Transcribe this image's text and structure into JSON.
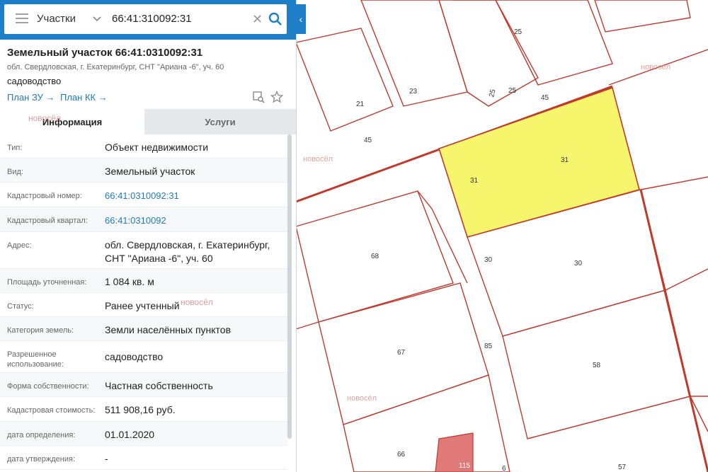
{
  "search": {
    "layer": "Участки",
    "value": "66:41:310092:31"
  },
  "object": {
    "title": "Земельный участок 66:41:0310092:31",
    "address_short": "обл. Свердловская, г. Екатеринбург, СНТ \"Ариана -6\", уч. 60",
    "usage": "садоводство",
    "plan_zu": "План ЗУ",
    "plan_kk": "План КК"
  },
  "tabs": [
    "Информация",
    "Услуги"
  ],
  "info_rows": [
    {
      "key": "Тип:",
      "value": "Объект недвижимости"
    },
    {
      "key": "Вид:",
      "value": "Земельный участок"
    },
    {
      "key": "Кадастровый номер:",
      "value": "66:41:0310092:31"
    },
    {
      "key": "Кадастровый квартал:",
      "value": "66:41:0310092"
    },
    {
      "key": "Адрес:",
      "value": "обл. Свердловская, г. Екатеринбург, СНТ \"Ариана -6\", уч. 60"
    },
    {
      "key": "Площадь уточненная:",
      "value": "1 084 кв. м"
    },
    {
      "key": "Статус:",
      "value": "Ранее учтенный"
    },
    {
      "key": "Категория земель:",
      "value": "Земли населённых пунктов"
    },
    {
      "key": "Разрешенное использование:",
      "value": "садоводство"
    },
    {
      "key": "Форма собственности:",
      "value": "Частная собственность"
    },
    {
      "key": "Кадастровая стоимость:",
      "value": "511 908,16 руб."
    },
    {
      "key": "дата определения:",
      "value": "01.01.2020"
    },
    {
      "key": "дата утверждения:",
      "value": "-"
    }
  ],
  "watermark": "новосёл",
  "map": {
    "labels": [
      "25",
      "25",
      "25",
      "23",
      "21",
      "45",
      "45",
      "31",
      "31",
      "30",
      "30",
      "68",
      "67",
      "85",
      "58",
      "66",
      "115",
      "57",
      "6"
    ],
    "highlight_color": "#f7f56b",
    "border_color": "#c0392b"
  }
}
